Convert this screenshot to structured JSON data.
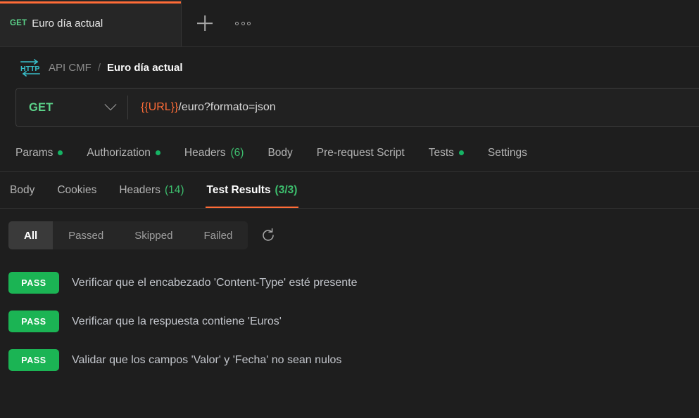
{
  "tabstrip": {
    "tabs": [
      {
        "method": "GET",
        "title": "Euro día actual",
        "active": true
      }
    ],
    "new_tab_icon": "plus-icon",
    "more_actions_icon": "ellipsis-icon"
  },
  "breadcrumb": {
    "protocol_icon": "http-icon",
    "parent": "API CMF",
    "separator": "/",
    "current": "Euro día actual"
  },
  "request": {
    "method": "GET",
    "method_chevron_icon": "chevron-down-icon",
    "url_variable": "{{URL}}",
    "url_path": "/euro?formato=json"
  },
  "request_tabs": [
    {
      "label": "Params",
      "dot": true,
      "count": "",
      "active": false
    },
    {
      "label": "Authorization",
      "dot": true,
      "count": "",
      "active": false
    },
    {
      "label": "Headers",
      "dot": false,
      "count": "(6)",
      "active": false
    },
    {
      "label": "Body",
      "dot": false,
      "count": "",
      "active": false
    },
    {
      "label": "Pre-request Script",
      "dot": false,
      "count": "",
      "active": false
    },
    {
      "label": "Tests",
      "dot": true,
      "count": "",
      "active": false
    },
    {
      "label": "Settings",
      "dot": false,
      "count": "",
      "active": false
    }
  ],
  "response_tabs": [
    {
      "label": "Body",
      "count": "",
      "active": false
    },
    {
      "label": "Cookies",
      "count": "",
      "active": false
    },
    {
      "label": "Headers",
      "count": "(14)",
      "active": false
    },
    {
      "label": "Test Results",
      "count": "(3/3)",
      "active": true
    }
  ],
  "filters": {
    "options": [
      "All",
      "Passed",
      "Skipped",
      "Failed"
    ],
    "selected": "All",
    "refresh_icon": "refresh-icon"
  },
  "test_results": [
    {
      "status": "PASS",
      "name": "Verificar que el encabezado 'Content-Type' esté presente"
    },
    {
      "status": "PASS",
      "name": "Verificar que la respuesta contiene 'Euros'"
    },
    {
      "status": "PASS",
      "name": "Validar que los campos 'Valor' y 'Fecha' no sean nulos"
    }
  ],
  "colors": {
    "accent_orange": "#ff6c37",
    "pass_green": "#1bb454",
    "method_green": "#5cd38a",
    "background": "#1e1e1e",
    "panel": "#262626",
    "http_icon_cyan": "#38bec9"
  }
}
